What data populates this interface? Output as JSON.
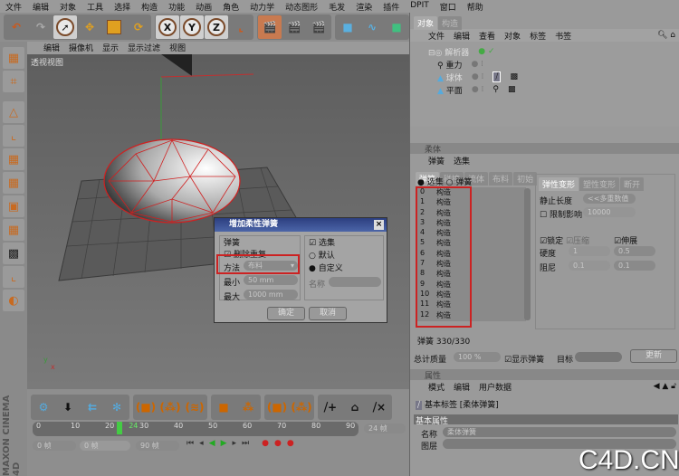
{
  "menubar": [
    "文件",
    "编辑",
    "对象",
    "工具",
    "选择",
    "构造",
    "功能",
    "动画",
    "角色",
    "动力学",
    "动态图形",
    "毛发",
    "渲染",
    "插件",
    "DPIT",
    "窗口",
    "帮助"
  ],
  "viewport": {
    "menu": [
      "编辑",
      "摄像机",
      "显示",
      "显示过滤",
      "视图"
    ],
    "label": "透视视图"
  },
  "toolbar": {
    "axis": [
      "X",
      "Y",
      "Z"
    ]
  },
  "dialog": {
    "title": "增加柔性弹簧",
    "spring_group": "弹簧",
    "delete_dup": "删除重复",
    "method_label": "方法",
    "method_value": "布料",
    "min_label": "最小",
    "min_value": "50 mm",
    "max_label": "最大",
    "max_value": "1000 mm",
    "sel_group": "选集",
    "default": "默认",
    "custom": "自定义",
    "name_label": "名称",
    "ok": "确定",
    "cancel": "取消"
  },
  "object_manager": {
    "tabs": [
      "对象",
      "构造"
    ],
    "menu": [
      "文件",
      "编辑",
      "查看",
      "对象",
      "标签",
      "书签"
    ],
    "tree": [
      "解析器",
      "重力",
      "球体",
      "平面"
    ]
  },
  "softbody": {
    "title": "柔体",
    "menu": [
      "弹簧",
      "选集"
    ],
    "tabs": [
      "弹簧",
      "碰撞",
      "流体",
      "布料",
      "初始"
    ],
    "radio_sel": "选集",
    "radio_spring": "弹簧",
    "springs": [
      {
        "i": "0",
        "t": "构造"
      },
      {
        "i": "1",
        "t": "构造"
      },
      {
        "i": "2",
        "t": "构造"
      },
      {
        "i": "3",
        "t": "构造"
      },
      {
        "i": "4",
        "t": "构造"
      },
      {
        "i": "5",
        "t": "构造"
      },
      {
        "i": "6",
        "t": "构造"
      },
      {
        "i": "7",
        "t": "构造"
      },
      {
        "i": "8",
        "t": "构造"
      },
      {
        "i": "9",
        "t": "构造"
      },
      {
        "i": "10",
        "t": "构造"
      },
      {
        "i": "11",
        "t": "构造"
      },
      {
        "i": "12",
        "t": "构造"
      }
    ],
    "count_label": "弹簧 330/330",
    "subtabs": [
      "弹性变形",
      "塑性变形",
      "断开"
    ],
    "rest_length": "静止长度",
    "rest_value": "<<多重数值",
    "limit": "限制影响",
    "limit_value": "10000",
    "lock": "锁定",
    "compress": "压缩",
    "stretch": "伸展",
    "hardness": "硬度",
    "hard1": "1",
    "hard2": "0.5",
    "damping": "阻尼",
    "damp1": "0.1",
    "damp2": "0.1",
    "total_mass": "总计质量",
    "mass_value": "100 %",
    "show_springs": "显示弹簧",
    "target": "目标",
    "update": "更新"
  },
  "attributes": {
    "title": "属性",
    "menu": [
      "模式",
      "编辑",
      "用户数据"
    ],
    "tag": "基本标签 [柔体弹簧]",
    "section": "基本属性",
    "name_label": "名称",
    "name_value": "柔体弹簧",
    "layer_label": "图层"
  },
  "timeline": {
    "ticks": [
      "0",
      "10",
      "20",
      "30",
      "40",
      "50",
      "60",
      "70",
      "80",
      "90"
    ],
    "current": "24",
    "fps": "24 帧",
    "start": "0 帧",
    "mid": "0 帧",
    "end": "90 帧"
  },
  "brand": "MAXON CINEMA 4D",
  "watermark": "C4D.CN"
}
